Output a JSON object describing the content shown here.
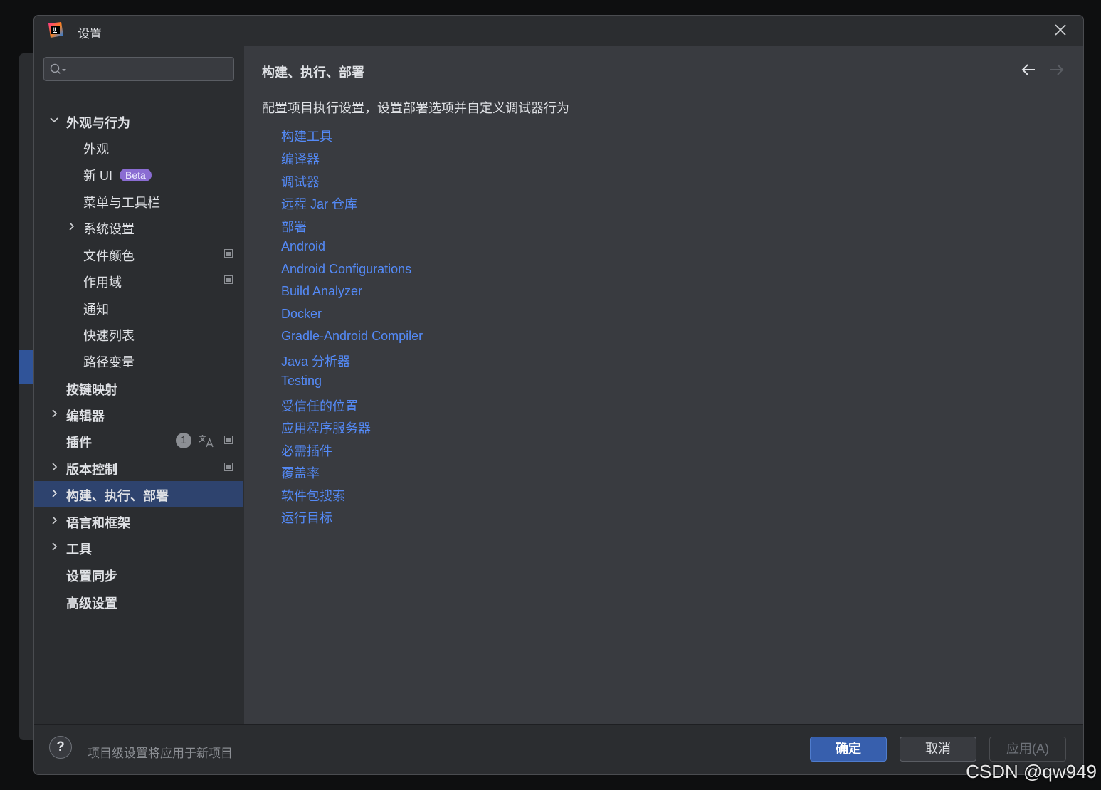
{
  "dialog": {
    "title": "设置"
  },
  "search": {
    "placeholder": ""
  },
  "sidebar": {
    "items": [
      {
        "label": "外观与行为",
        "bold": true,
        "expanded": true
      },
      {
        "label": "外观"
      },
      {
        "label": "新 UI",
        "badge": "Beta"
      },
      {
        "label": "菜单与工具栏"
      },
      {
        "label": "系统设置",
        "collapsed": true
      },
      {
        "label": "文件颜色",
        "project_icon": true
      },
      {
        "label": "作用域",
        "project_icon": true
      },
      {
        "label": "通知"
      },
      {
        "label": "快速列表"
      },
      {
        "label": "路径变量"
      },
      {
        "label": "按键映射",
        "bold": true
      },
      {
        "label": "编辑器",
        "bold": true,
        "collapsed": true
      },
      {
        "label": "插件",
        "bold": true,
        "count": "1",
        "project_icon": true
      },
      {
        "label": "版本控制",
        "bold": true,
        "collapsed": true,
        "project_icon": true
      },
      {
        "label": "构建、执行、部署",
        "bold": true,
        "collapsed": true,
        "selected": true
      },
      {
        "label": "语言和框架",
        "bold": true,
        "collapsed": true
      },
      {
        "label": "工具",
        "bold": true,
        "collapsed": true
      },
      {
        "label": "设置同步",
        "bold": true
      },
      {
        "label": "高级设置",
        "bold": true
      }
    ]
  },
  "content": {
    "breadcrumb": "构建、执行、部署",
    "description": "配置项目执行设置，设置部署选项并自定义调试器行为",
    "links": [
      "构建工具",
      "编译器",
      "调试器",
      "远程 Jar 仓库",
      "部署",
      "Android",
      "Android Configurations",
      "Build Analyzer",
      "Docker",
      "Gradle-Android Compiler",
      "Java 分析器",
      "Testing",
      "受信任的位置",
      "应用程序服务器",
      "必需插件",
      "覆盖率",
      "软件包搜索",
      "运行目标"
    ]
  },
  "footer": {
    "help": "?",
    "note": "项目级设置将应用于新项目",
    "ok": "确定",
    "cancel": "取消",
    "apply": "应用(A)"
  },
  "watermark": "CSDN @qw949",
  "colors": {
    "accent": "#3574f0",
    "link": "#548af7",
    "selection": "#2e436e",
    "beta": "#8a6cd2"
  }
}
